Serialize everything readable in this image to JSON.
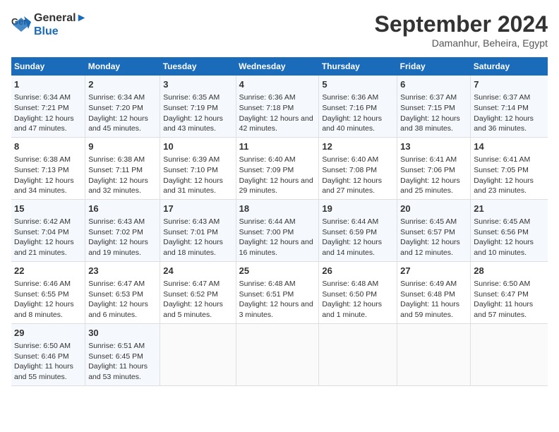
{
  "logo": {
    "line1": "General",
    "line2": "Blue"
  },
  "title": "September 2024",
  "subtitle": "Damanhur, Beheira, Egypt",
  "days_of_week": [
    "Sunday",
    "Monday",
    "Tuesday",
    "Wednesday",
    "Thursday",
    "Friday",
    "Saturday"
  ],
  "weeks": [
    [
      {
        "day": "1",
        "sunrise": "6:34 AM",
        "sunset": "7:21 PM",
        "daylight": "12 hours and 47 minutes."
      },
      {
        "day": "2",
        "sunrise": "6:34 AM",
        "sunset": "7:20 PM",
        "daylight": "12 hours and 45 minutes."
      },
      {
        "day": "3",
        "sunrise": "6:35 AM",
        "sunset": "7:19 PM",
        "daylight": "12 hours and 43 minutes."
      },
      {
        "day": "4",
        "sunrise": "6:36 AM",
        "sunset": "7:18 PM",
        "daylight": "12 hours and 42 minutes."
      },
      {
        "day": "5",
        "sunrise": "6:36 AM",
        "sunset": "7:16 PM",
        "daylight": "12 hours and 40 minutes."
      },
      {
        "day": "6",
        "sunrise": "6:37 AM",
        "sunset": "7:15 PM",
        "daylight": "12 hours and 38 minutes."
      },
      {
        "day": "7",
        "sunrise": "6:37 AM",
        "sunset": "7:14 PM",
        "daylight": "12 hours and 36 minutes."
      }
    ],
    [
      {
        "day": "8",
        "sunrise": "6:38 AM",
        "sunset": "7:13 PM",
        "daylight": "12 hours and 34 minutes."
      },
      {
        "day": "9",
        "sunrise": "6:38 AM",
        "sunset": "7:11 PM",
        "daylight": "12 hours and 32 minutes."
      },
      {
        "day": "10",
        "sunrise": "6:39 AM",
        "sunset": "7:10 PM",
        "daylight": "12 hours and 31 minutes."
      },
      {
        "day": "11",
        "sunrise": "6:40 AM",
        "sunset": "7:09 PM",
        "daylight": "12 hours and 29 minutes."
      },
      {
        "day": "12",
        "sunrise": "6:40 AM",
        "sunset": "7:08 PM",
        "daylight": "12 hours and 27 minutes."
      },
      {
        "day": "13",
        "sunrise": "6:41 AM",
        "sunset": "7:06 PM",
        "daylight": "12 hours and 25 minutes."
      },
      {
        "day": "14",
        "sunrise": "6:41 AM",
        "sunset": "7:05 PM",
        "daylight": "12 hours and 23 minutes."
      }
    ],
    [
      {
        "day": "15",
        "sunrise": "6:42 AM",
        "sunset": "7:04 PM",
        "daylight": "12 hours and 21 minutes."
      },
      {
        "day": "16",
        "sunrise": "6:43 AM",
        "sunset": "7:02 PM",
        "daylight": "12 hours and 19 minutes."
      },
      {
        "day": "17",
        "sunrise": "6:43 AM",
        "sunset": "7:01 PM",
        "daylight": "12 hours and 18 minutes."
      },
      {
        "day": "18",
        "sunrise": "6:44 AM",
        "sunset": "7:00 PM",
        "daylight": "12 hours and 16 minutes."
      },
      {
        "day": "19",
        "sunrise": "6:44 AM",
        "sunset": "6:59 PM",
        "daylight": "12 hours and 14 minutes."
      },
      {
        "day": "20",
        "sunrise": "6:45 AM",
        "sunset": "6:57 PM",
        "daylight": "12 hours and 12 minutes."
      },
      {
        "day": "21",
        "sunrise": "6:45 AM",
        "sunset": "6:56 PM",
        "daylight": "12 hours and 10 minutes."
      }
    ],
    [
      {
        "day": "22",
        "sunrise": "6:46 AM",
        "sunset": "6:55 PM",
        "daylight": "12 hours and 8 minutes."
      },
      {
        "day": "23",
        "sunrise": "6:47 AM",
        "sunset": "6:53 PM",
        "daylight": "12 hours and 6 minutes."
      },
      {
        "day": "24",
        "sunrise": "6:47 AM",
        "sunset": "6:52 PM",
        "daylight": "12 hours and 5 minutes."
      },
      {
        "day": "25",
        "sunrise": "6:48 AM",
        "sunset": "6:51 PM",
        "daylight": "12 hours and 3 minutes."
      },
      {
        "day": "26",
        "sunrise": "6:48 AM",
        "sunset": "6:50 PM",
        "daylight": "12 hours and 1 minute."
      },
      {
        "day": "27",
        "sunrise": "6:49 AM",
        "sunset": "6:48 PM",
        "daylight": "11 hours and 59 minutes."
      },
      {
        "day": "28",
        "sunrise": "6:50 AM",
        "sunset": "6:47 PM",
        "daylight": "11 hours and 57 minutes."
      }
    ],
    [
      {
        "day": "29",
        "sunrise": "6:50 AM",
        "sunset": "6:46 PM",
        "daylight": "11 hours and 55 minutes."
      },
      {
        "day": "30",
        "sunrise": "6:51 AM",
        "sunset": "6:45 PM",
        "daylight": "11 hours and 53 minutes."
      },
      null,
      null,
      null,
      null,
      null
    ]
  ]
}
